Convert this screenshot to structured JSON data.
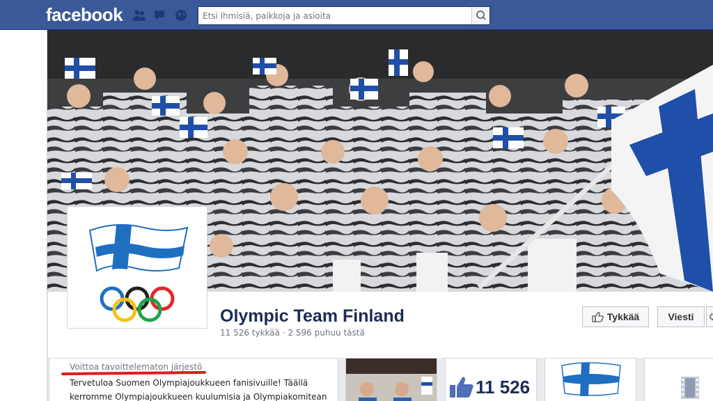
{
  "topbar": {
    "logo": "facebook",
    "search_placeholder": "Etsi ihmisiä, paikkoja ja asioita"
  },
  "page": {
    "title": "Olympic Team Finland",
    "stats": "11 526 tykkää · 2 596 puhuu tästä"
  },
  "actions": {
    "like_label": "Tykkää",
    "message_label": "Viesti"
  },
  "about": {
    "category": "Voittoa tavoittelematon järjestö",
    "lines": [
      "Tervetuloa Suomen Olympiajoukkueen fanisivuille! Täällä",
      "kerromme Olympiajoukkueen kuulumisia ja Olympiakomitean"
    ]
  },
  "apps": {
    "likes_count": "11 526"
  },
  "colors": {
    "facebook_blue": "#3b5998",
    "title_navy": "#1c2b55",
    "finland_blue": "#1f6fc1",
    "annotation_red": "#e41919"
  }
}
